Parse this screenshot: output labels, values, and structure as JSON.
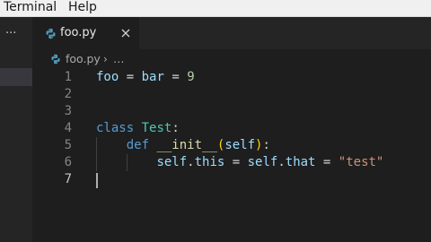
{
  "menu": {
    "items": [
      "Terminal",
      "Help"
    ]
  },
  "sidebar": {
    "more_label": "···"
  },
  "tab": {
    "label": "foo.py",
    "icon": "python-file-icon",
    "close_icon": "close-icon"
  },
  "breadcrumb": {
    "file": "foo.py",
    "separator": "›",
    "more": "…"
  },
  "editor": {
    "line_numbers": [
      "1",
      "2",
      "3",
      "4",
      "5",
      "6",
      "7"
    ],
    "active_line": "7",
    "lines": [
      [
        {
          "t": "foo",
          "c": "var"
        },
        {
          "t": " = ",
          "c": "op"
        },
        {
          "t": "bar",
          "c": "var"
        },
        {
          "t": " = ",
          "c": "op"
        },
        {
          "t": "9",
          "c": "num"
        }
      ],
      [],
      [],
      [
        {
          "t": "class",
          "c": "kw"
        },
        {
          "t": " ",
          "c": "op"
        },
        {
          "t": "Test",
          "c": "cls"
        },
        {
          "t": ":",
          "c": "op"
        }
      ],
      [
        {
          "t": "    ",
          "c": "op"
        },
        {
          "t": "def",
          "c": "kw"
        },
        {
          "t": " ",
          "c": "op"
        },
        {
          "t": "__init__",
          "c": "fn"
        },
        {
          "t": "(",
          "c": "paren"
        },
        {
          "t": "self",
          "c": "self"
        },
        {
          "t": ")",
          "c": "paren"
        },
        {
          "t": ":",
          "c": "op"
        }
      ],
      [
        {
          "t": "        ",
          "c": "op"
        },
        {
          "t": "self",
          "c": "self"
        },
        {
          "t": ".",
          "c": "op"
        },
        {
          "t": "this",
          "c": "var"
        },
        {
          "t": " = ",
          "c": "op"
        },
        {
          "t": "self",
          "c": "self"
        },
        {
          "t": ".",
          "c": "op"
        },
        {
          "t": "that",
          "c": "var"
        },
        {
          "t": " = ",
          "c": "op"
        },
        {
          "t": "\"test\"",
          "c": "str"
        }
      ],
      []
    ]
  },
  "colors": {
    "background": "#1e1e1e",
    "keyword": "#569cd6",
    "class_name": "#4ec9b0",
    "function": "#dcdcaa",
    "string": "#ce9178",
    "number": "#b5cea8",
    "variable": "#9cdcfe"
  }
}
